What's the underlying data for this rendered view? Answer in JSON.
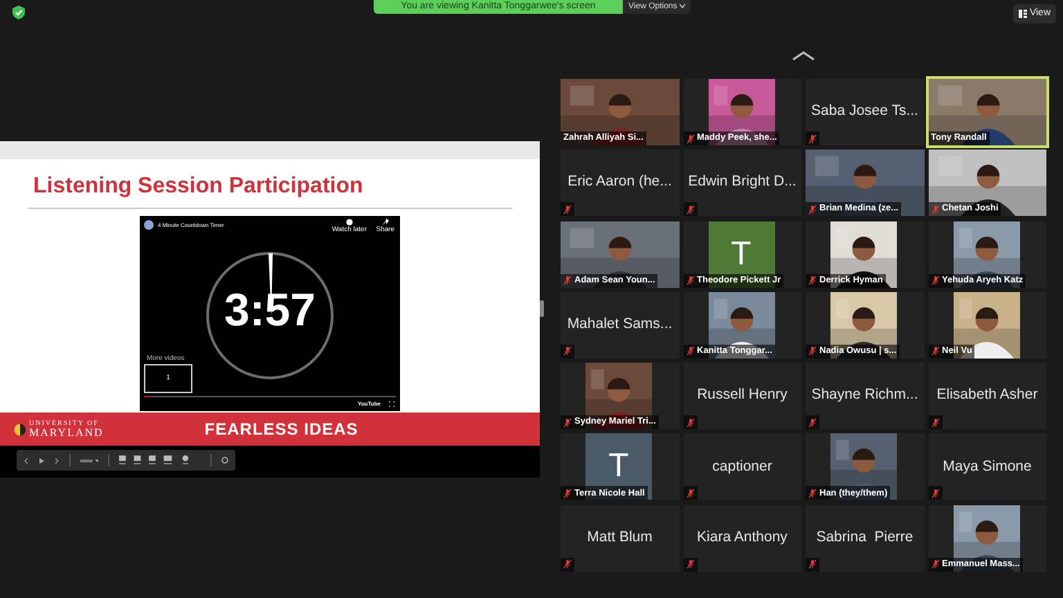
{
  "banner": {
    "text": "You are viewing Kanitta Tonggarwee's screen",
    "options": "View Options"
  },
  "view_button": "View",
  "slide": {
    "title": "Listening Session Participation",
    "player": {
      "title": "4 Minute Countdown Timer",
      "watch_later": "Watch later",
      "share": "Share",
      "time": "3:57",
      "more_videos": "More videos",
      "thumb_number": "1",
      "brand": "YouTube",
      "progress": {
        "level": 0.02
      }
    },
    "logo_top": "UNIVERSITY OF",
    "logo_bottom": "MARYLAND",
    "tagline": "FEARLESS IDEAS"
  },
  "participants": [
    {
      "name": "Zahrah Alliyah Si...",
      "kind": "video",
      "muted": false,
      "speaking": false
    },
    {
      "name": "Maddy Peek, she...",
      "kind": "portrait",
      "muted": true,
      "speaking": false
    },
    {
      "name": "Saba Josee Ts...",
      "kind": "name",
      "muted": true,
      "speaking": false
    },
    {
      "name": "Tony Randall",
      "kind": "video",
      "muted": false,
      "speaking": true
    },
    {
      "name": "Eric Aaron (he...",
      "kind": "name",
      "muted": true,
      "speaking": false
    },
    {
      "name": "Edwin Bright D...",
      "kind": "name",
      "muted": true,
      "speaking": false
    },
    {
      "name": "Brian Medina (ze...",
      "kind": "video",
      "muted": true,
      "speaking": false
    },
    {
      "name": "Chetan Joshi",
      "kind": "video",
      "muted": true,
      "speaking": false
    },
    {
      "name": "Adam Sean Youn...",
      "kind": "video",
      "muted": true,
      "speaking": false
    },
    {
      "name": "Theodore Pickett Jr",
      "kind": "avatar",
      "letter": "T",
      "color": "#4e7a36",
      "muted": true,
      "speaking": false
    },
    {
      "name": "Derrick Hyman",
      "kind": "portrait",
      "muted": true,
      "speaking": false
    },
    {
      "name": "Yehuda Aryeh Katz",
      "kind": "portrait",
      "muted": true,
      "speaking": false
    },
    {
      "name": "Mahalet Sams...",
      "kind": "name",
      "muted": true,
      "speaking": false
    },
    {
      "name": "Kanitta Tonggar...",
      "kind": "portrait",
      "muted": true,
      "speaking": false
    },
    {
      "name": "Nadia Owusu | s...",
      "kind": "portrait",
      "muted": true,
      "speaking": false
    },
    {
      "name": "Neil Vu",
      "kind": "portrait",
      "muted": true,
      "speaking": false
    },
    {
      "name": "Sydney Mariel Tri...",
      "kind": "portrait",
      "muted": true,
      "speaking": false
    },
    {
      "name": "Russell Henry",
      "kind": "name",
      "muted": true,
      "speaking": false
    },
    {
      "name": "Shayne Richm...",
      "kind": "name",
      "muted": true,
      "speaking": false
    },
    {
      "name": "Elisabeth Asher",
      "kind": "name",
      "muted": true,
      "speaking": false
    },
    {
      "name": "Terra Nicole Hall",
      "kind": "avatar",
      "letter": "T",
      "color": "#4a5a66",
      "muted": true,
      "speaking": false
    },
    {
      "name": "captioner",
      "kind": "name",
      "muted": true,
      "speaking": false
    },
    {
      "name": "Han (they/them)",
      "kind": "portrait",
      "muted": true,
      "speaking": false
    },
    {
      "name": "Maya Simone",
      "kind": "name",
      "muted": true,
      "speaking": false
    },
    {
      "name": "Matt Blum",
      "kind": "name",
      "muted": true,
      "speaking": false
    },
    {
      "name": "Kiara Anthony",
      "kind": "name",
      "muted": true,
      "speaking": false
    },
    {
      "name": "Sabrina  Pierre",
      "kind": "name",
      "muted": true,
      "speaking": false
    },
    {
      "name": "Emmanuel Mass...",
      "kind": "portrait",
      "muted": true,
      "speaking": false
    }
  ]
}
